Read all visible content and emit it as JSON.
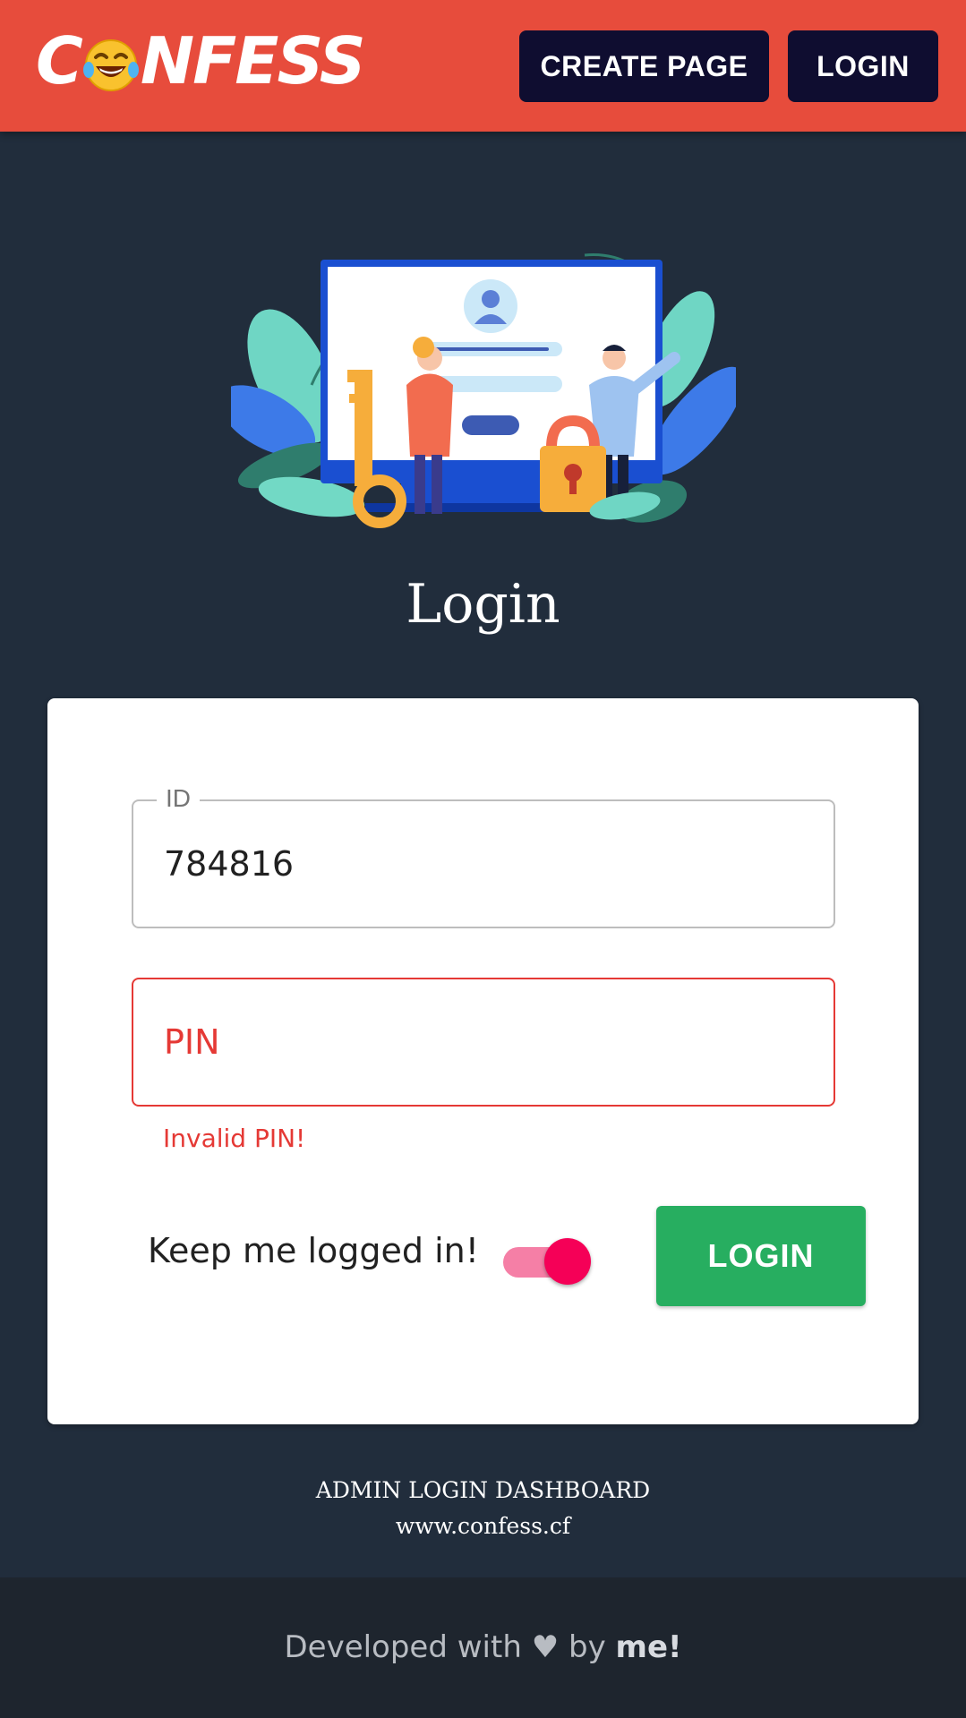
{
  "header": {
    "logo_text_start": "C",
    "logo_text_end": "NFESS",
    "create_page_label": "CREATE PAGE",
    "login_label": "LOGIN",
    "brand_color": "#e74c3c",
    "nav_button_color": "#0f0d30"
  },
  "page": {
    "title": "Login",
    "background_color": "#212d3c"
  },
  "form": {
    "id_label": "ID",
    "id_value": "784816",
    "pin_placeholder": "PIN",
    "pin_value": "",
    "pin_error": "Invalid PIN!",
    "keep_logged_in_label": "Keep me logged in!",
    "keep_logged_in_checked": true,
    "submit_label": "LOGIN",
    "error_color": "#e53935",
    "submit_color": "#27ae60",
    "toggle_color": "#f50057"
  },
  "footer": {
    "line1": "ADMIN LOGIN DASHBOARD",
    "line2": "www.confess.cf",
    "dev_prefix": "Developed with",
    "dev_heart": "♥",
    "dev_by": "by",
    "dev_name": "me!"
  },
  "icons": {
    "logo_emoji": "face-with-tears-of-joy-icon",
    "illustration": "login-illustration"
  }
}
